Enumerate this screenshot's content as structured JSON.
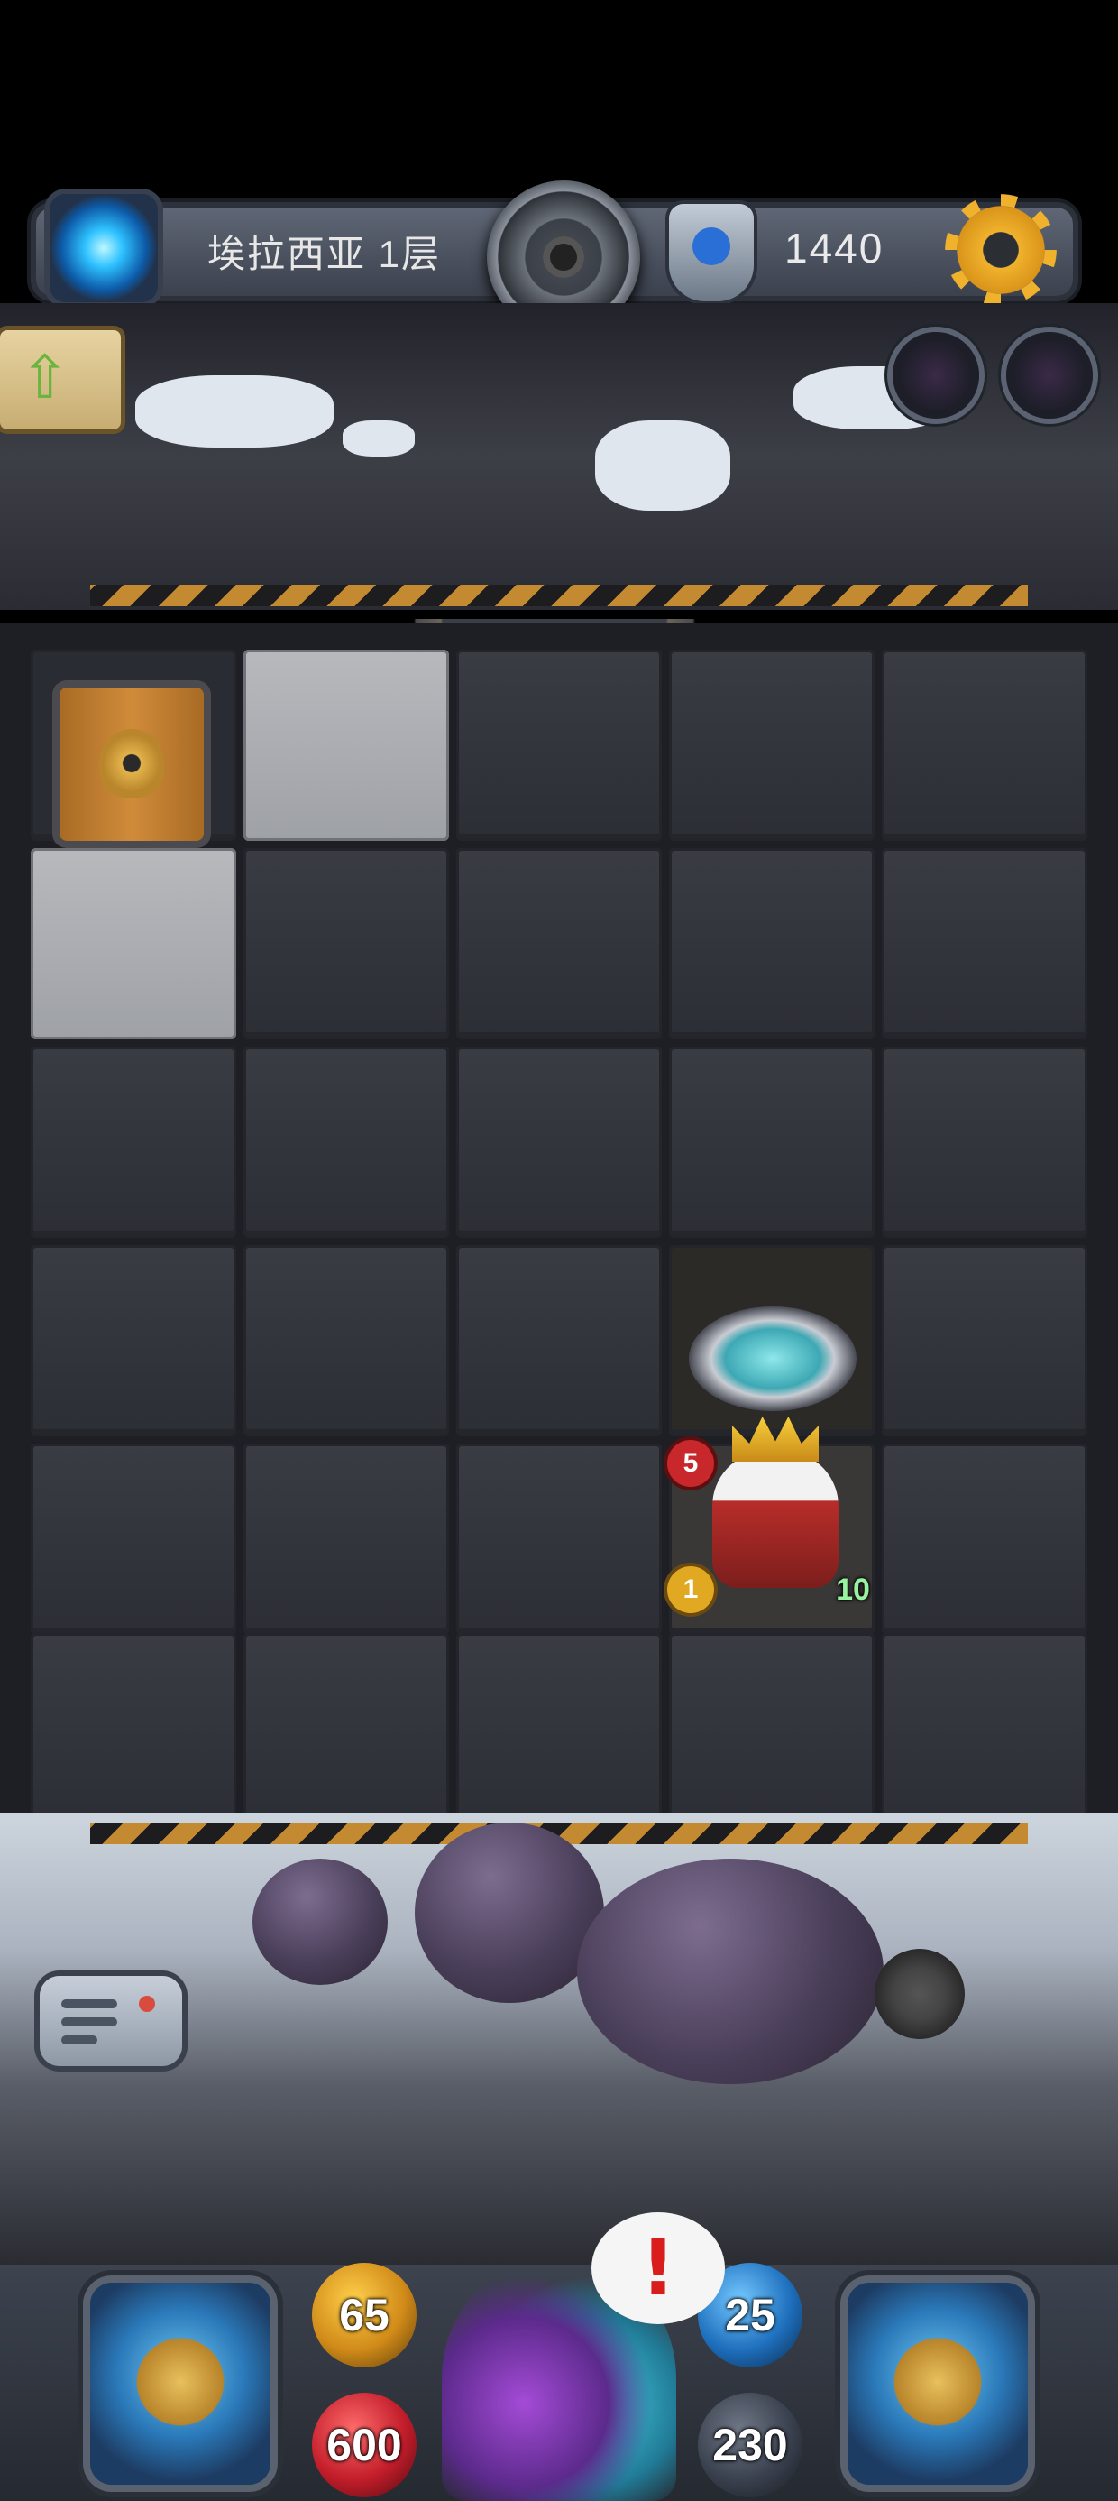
{
  "top_bar": {
    "floor_label": "埃拉西亚 1层",
    "currency_value": "1440"
  },
  "board": {
    "enemy": {
      "top_badge": "5",
      "bottom_left_badge": "1",
      "bottom_right_badge": "10"
    }
  },
  "hud": {
    "attack": "65",
    "defense": "25",
    "health": "600",
    "gold": "230",
    "alert": "!"
  },
  "colors": {
    "accent_gold": "#f0b22d",
    "hazard_orange": "#c48a32"
  }
}
